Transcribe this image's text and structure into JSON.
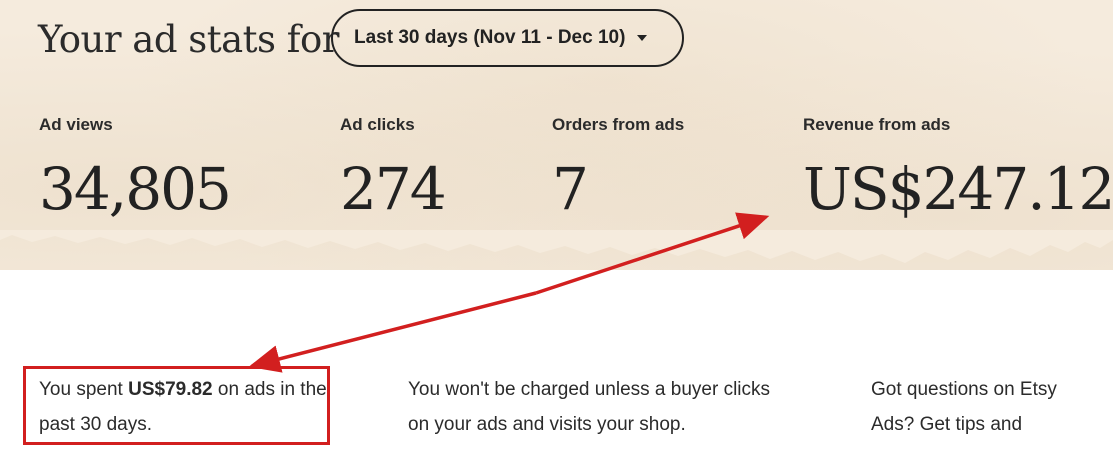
{
  "header": {
    "title": "Your ad stats for",
    "date_range": "Last 30 days (Nov 11 - Dec 10)"
  },
  "stats": [
    {
      "label": "Ad views",
      "value": "34,805"
    },
    {
      "label": "Ad clicks",
      "value": "274"
    },
    {
      "label": "Orders from ads",
      "value": "7"
    },
    {
      "label": "Revenue from ads",
      "value": "US$247.12"
    }
  ],
  "info": {
    "spent_prefix": "You spent ",
    "spent_amount": "US$79.82",
    "spent_suffix": " on ads in the past 30 days.",
    "charge_note": "You won't be charged unless a buyer clicks on your ads and visits your shop.",
    "questions": "Got questions on Etsy Ads? Get tips and"
  },
  "colors": {
    "banner_bg": "#f5ebdd",
    "annotation_red": "#d21f1f",
    "text_dark": "#222222"
  },
  "icons": {
    "dropdown": "caret-down-icon"
  }
}
